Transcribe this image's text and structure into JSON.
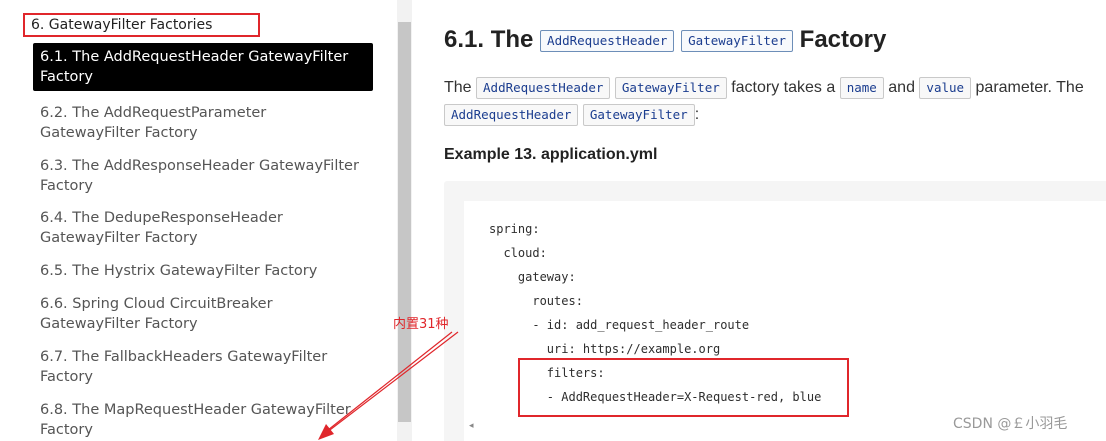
{
  "sidebar": {
    "section_title": "6. GatewayFilter Factories",
    "items": [
      {
        "label": "6.1. The AddRequestHeader GatewayFilter Factory",
        "active": true
      },
      {
        "label": "6.2. The AddRequestParameter GatewayFilter Factory",
        "active": false
      },
      {
        "label": "6.3. The AddResponseHeader GatewayFilter Factory",
        "active": false
      },
      {
        "label": "6.4. The DedupeResponseHeader GatewayFilter Factory",
        "active": false
      },
      {
        "label": "6.5. The Hystrix GatewayFilter Factory",
        "active": false
      },
      {
        "label": "6.6. Spring Cloud CircuitBreaker GatewayFilter Factory",
        "active": false
      },
      {
        "label": "6.7. The FallbackHeaders GatewayFilter Factory",
        "active": false
      },
      {
        "label": "6.8. The MapRequestHeader GatewayFilter Factory",
        "active": false
      }
    ]
  },
  "main": {
    "heading_prefix": "6.1. The",
    "heading_chip1": "AddRequestHeader",
    "heading_chip2": "GatewayFilter",
    "heading_suffix": "Factory",
    "para": {
      "t1": "The",
      "chip1": "AddRequestHeader",
      "chip2": "GatewayFilter",
      "t2": "factory takes a",
      "chip3": "name",
      "t3": "and",
      "chip4": "value",
      "t4": "parameter. The",
      "chip5": "AddRequestHeader",
      "chip6": "GatewayFilter",
      "t5": ":"
    },
    "example_title": "Example 13. application.yml",
    "code": [
      "spring:",
      "  cloud:",
      "    gateway:",
      "      routes:",
      "      - id: add_request_header_route",
      "        uri: https://example.org",
      "        filters:",
      "        - AddRequestHeader=X-Request-red, blue"
    ],
    "code_scroll_glyph": "◂"
  },
  "annotation": {
    "label": "内置31种",
    "color": "#e0262b"
  },
  "watermark": "CSDN @￡小羽毛"
}
